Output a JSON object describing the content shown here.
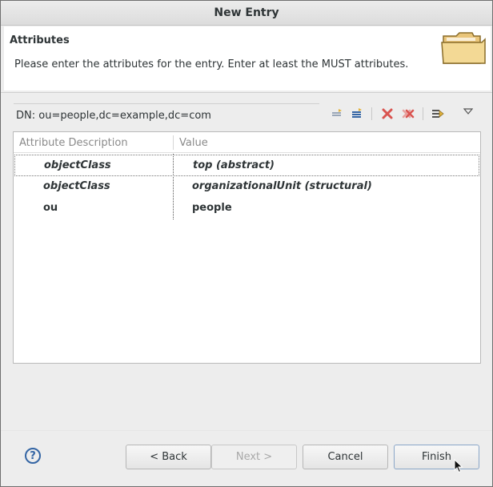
{
  "window": {
    "title": "New Entry"
  },
  "header": {
    "title": "Attributes",
    "description": "Please enter the attributes for the entry. Enter at least the MUST attributes.",
    "icon": "folder-icon"
  },
  "dn": {
    "label": "DN: ou=people,dc=example,dc=com"
  },
  "toolbar": {
    "icons": [
      "new-value-icon",
      "new-attribute-icon",
      "delete-icon",
      "delete-all-icon",
      "edit-value-icon",
      "view-menu-icon"
    ]
  },
  "table": {
    "columns": [
      "Attribute Description",
      "Value"
    ],
    "rows": [
      {
        "attribute": "objectClass",
        "value": "top (abstract)"
      },
      {
        "attribute": "objectClass",
        "value": "organizationalUnit (structural)"
      },
      {
        "attribute": "ou",
        "value": "people"
      }
    ]
  },
  "buttons": {
    "back": "< Back",
    "next": "Next >",
    "cancel": "Cancel",
    "finish": "Finish",
    "help_symbol": "?"
  },
  "colors": {
    "accent": "#3465a4",
    "delete": "#d9534f"
  }
}
